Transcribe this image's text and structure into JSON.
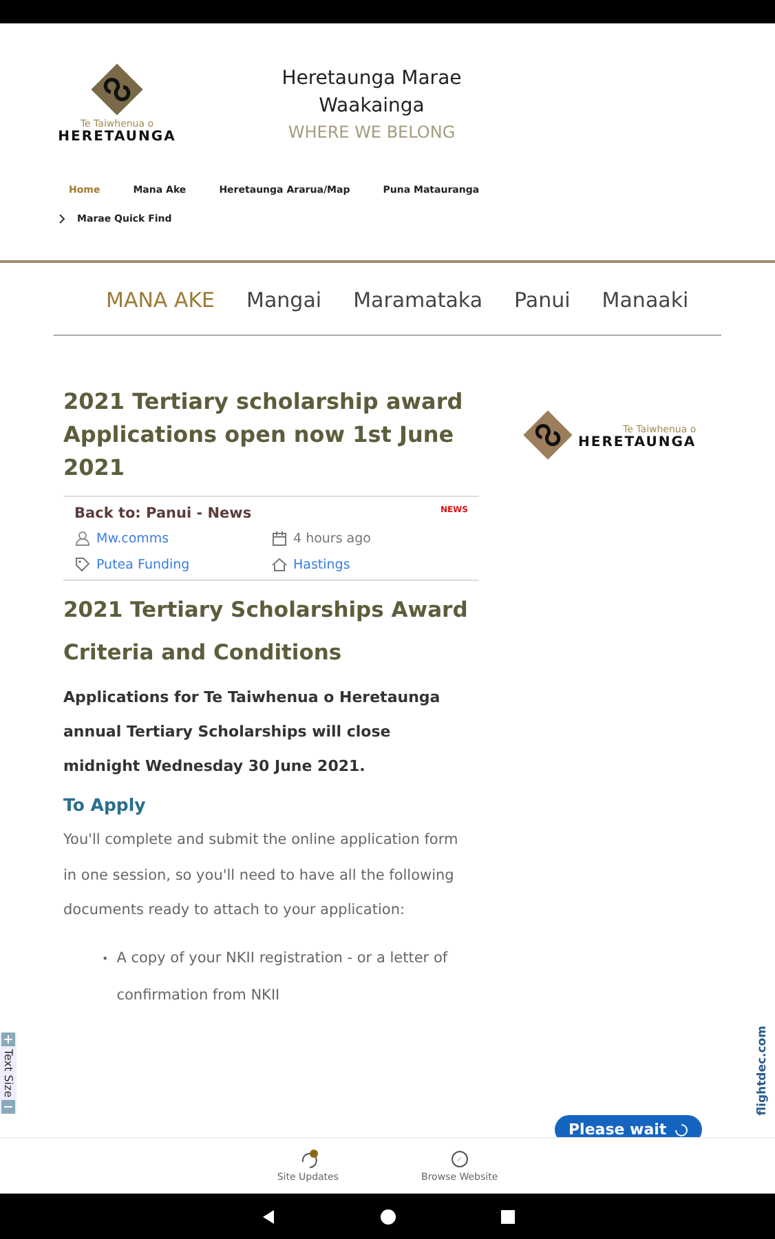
{
  "site": {
    "logo_small_text": "Te Taiwhenua o",
    "logo_text": "HERETAUNGA",
    "title": "Heretaunga Marae Waakainga",
    "tagline": "WHERE WE BELONG"
  },
  "top_menu": [
    {
      "label": "Home",
      "selected": true
    },
    {
      "label": "Mana Ake",
      "selected": false
    },
    {
      "label": "Heretaunga Ararua/Map",
      "selected": false
    },
    {
      "label": "Puna Matauranga",
      "selected": false
    },
    {
      "label": "Marae Quick Find",
      "selected": false
    }
  ],
  "main_nav": [
    {
      "label": "MANA AKE",
      "selected": true
    },
    {
      "label": "Mangai",
      "selected": false
    },
    {
      "label": "Maramataka",
      "selected": false
    },
    {
      "label": "Panui",
      "selected": false
    },
    {
      "label": "Manaaki",
      "selected": false
    }
  ],
  "article": {
    "title": "2021 Tertiary scholarship award Applications open now 1st June 2021",
    "back_link": "Back to: Panui - News",
    "tag": "NEWS",
    "meta": [
      {
        "kind": "author",
        "text": "Mw.comms",
        "link": true
      },
      {
        "kind": "time",
        "text": "4 hours ago",
        "link": false
      },
      {
        "kind": "category",
        "text": "Putea Funding",
        "link": true
      },
      {
        "kind": "location",
        "text": "Hastings",
        "link": true
      }
    ],
    "heading": "2021 Tertiary Scholarships Award Criteria and Conditions",
    "intro": "Applications for Te Taiwhenua o Heretaunga annual Tertiary Scholarships will close midnight Wednesday 30 June 2021.",
    "subheading": "To Apply",
    "body": "You'll complete and submit the online application form in one session, so you'll need to have all the following documents ready to attach to your application:",
    "bullets": [
      {
        "marker": "•",
        "text": "A copy of your NKII registration - or a letter of confirmation from NKII"
      }
    ]
  },
  "sidebar": {
    "logo_small_text": "Te Taiwhenua o",
    "logo_text": "HERETAUNGA"
  },
  "text_size_widget": "Text Size",
  "brand_mark": "flightdec.com",
  "wait_button": "Please wait",
  "bottom_bar": [
    {
      "kind": "updates",
      "label": "Site Updates"
    },
    {
      "kind": "browse",
      "label": "Browse Website"
    }
  ]
}
